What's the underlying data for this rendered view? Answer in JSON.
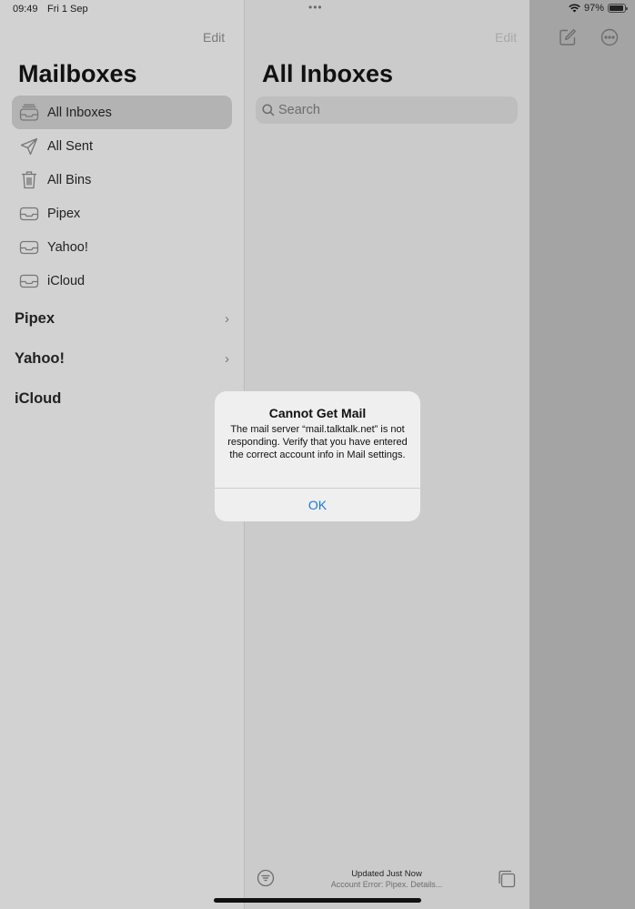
{
  "status_bar": {
    "time": "09:49",
    "date": "Fri 1 Sep",
    "battery": "97%"
  },
  "sidebar": {
    "edit_label": "Edit",
    "title": "Mailboxes",
    "mailboxes": [
      {
        "label": "All Inboxes",
        "icon": "tray-stack-icon",
        "selected": true
      },
      {
        "label": "All Sent",
        "icon": "paperplane-icon"
      },
      {
        "label": "All Bins",
        "icon": "trash-icon"
      },
      {
        "label": "Pipex",
        "icon": "tray-icon"
      },
      {
        "label": "Yahoo!",
        "icon": "tray-icon"
      },
      {
        "label": "iCloud",
        "icon": "tray-icon"
      }
    ],
    "accounts": [
      {
        "label": "Pipex",
        "chevron": "›"
      },
      {
        "label": "Yahoo!",
        "chevron": "›"
      },
      {
        "label": "iCloud"
      }
    ]
  },
  "main": {
    "edit_label": "Edit",
    "title": "All Inboxes",
    "search_placeholder": "Search",
    "footer": {
      "updated": "Updated Just Now",
      "error": "Account Error: Pipex. Details..."
    }
  },
  "alert": {
    "title": "Cannot Get Mail",
    "message": "The mail server “mail.talktalk.net” is not responding. Verify that you have entered the correct account info in Mail settings.",
    "ok_label": "OK"
  },
  "colors": {
    "accent": "#1a78e0",
    "selected_row": "#b3b3b3"
  }
}
